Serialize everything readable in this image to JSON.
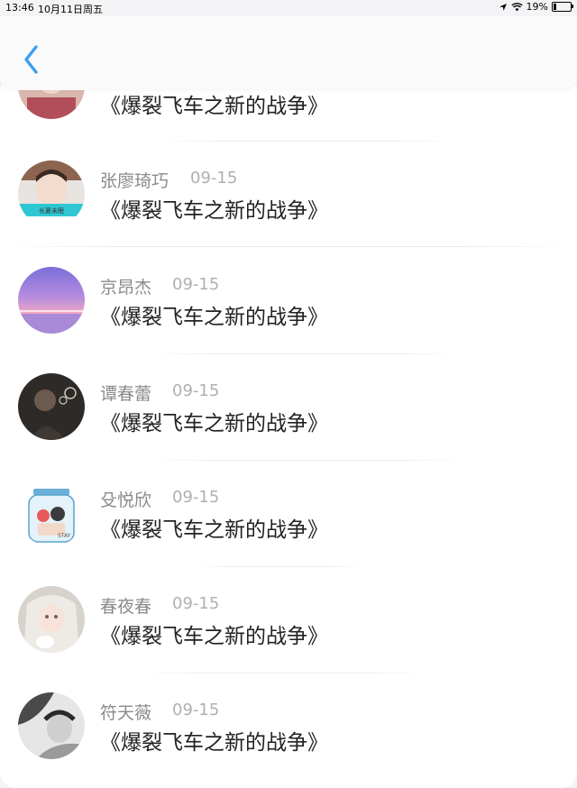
{
  "status_bar": {
    "time": "13:46",
    "date": "10月11日周五",
    "battery": "19%",
    "battery_level": 0.19,
    "icons": [
      "location-arrow-icon",
      "wifi-icon",
      "battery-icon"
    ]
  },
  "header": {
    "back_icon": "chevron-left-icon",
    "accent_color": "#3a9ff0"
  },
  "comments": [
    {
      "user": "",
      "date": "",
      "content": "《爆裂飞车之新的战争》"
    },
    {
      "user": "张廖琦巧",
      "date": "09-15",
      "content": "《爆裂飞车之新的战争》"
    },
    {
      "user": "京昂杰",
      "date": "09-15",
      "content": "《爆裂飞车之新的战争》"
    },
    {
      "user": "谭春蕾",
      "date": "09-15",
      "content": "《爆裂飞车之新的战争》"
    },
    {
      "user": "殳悦欣",
      "date": "09-15",
      "content": "《爆裂飞车之新的战争》"
    },
    {
      "user": "春夜春",
      "date": "09-15",
      "content": "《爆裂飞车之新的战争》"
    },
    {
      "user": "符天薇",
      "date": "09-15",
      "content": "《爆裂飞车之新的战争》"
    }
  ]
}
